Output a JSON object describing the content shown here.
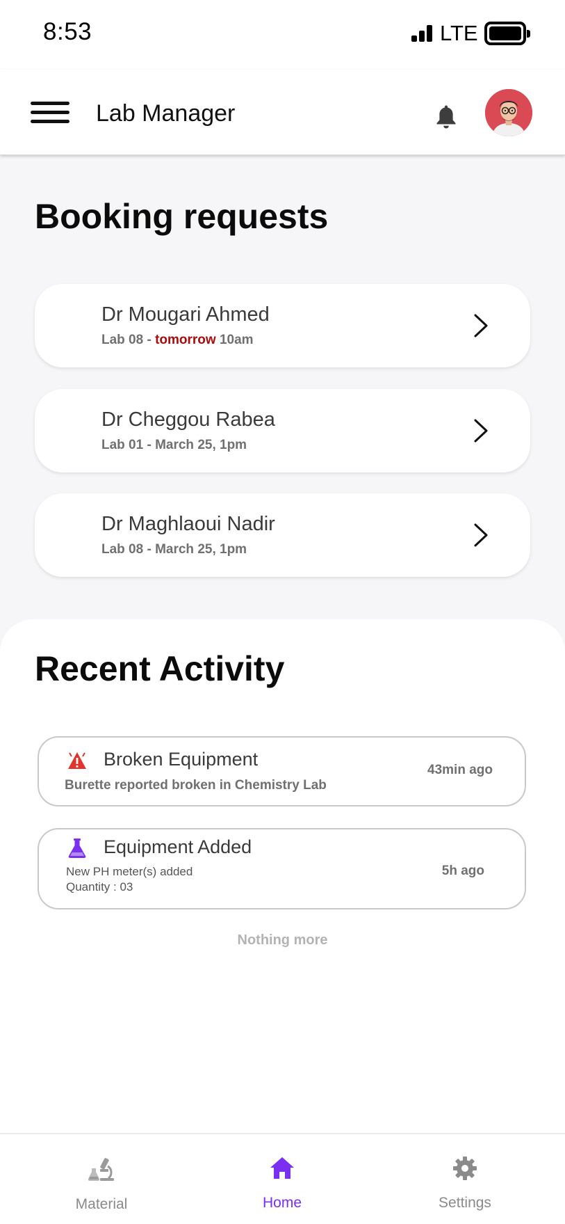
{
  "status_bar": {
    "time": "8:53",
    "network": "LTE"
  },
  "header": {
    "title": "Lab Manager"
  },
  "booking_section": {
    "title": "Booking requests",
    "items": [
      {
        "name": "Dr Mougari Ahmed",
        "lab": "Lab 08 - ",
        "highlight": "tomorrow",
        "time": " 10am"
      },
      {
        "name": "Dr Cheggou Rabea",
        "lab": "Lab 01 - March 25, 1pm",
        "highlight": "",
        "time": ""
      },
      {
        "name": "Dr Maghlaoui Nadir",
        "lab": "Lab 08 - March 25, 1pm",
        "highlight": "",
        "time": ""
      }
    ]
  },
  "activity_section": {
    "title": "Recent Activity",
    "items": [
      {
        "icon": "warning-icon",
        "title": "Broken Equipment",
        "description": "Burette reported broken in Chemistry Lab",
        "time": "43min ago"
      },
      {
        "icon": "flask-icon",
        "title": "Equipment Added",
        "line1": "New PH meter(s) added",
        "line2": "Quantity : 03",
        "time": "5h ago"
      }
    ],
    "footer": "Nothing more"
  },
  "bottom_nav": {
    "items": [
      {
        "label": "Material",
        "icon": "microscope-icon",
        "active": false
      },
      {
        "label": "Home",
        "icon": "home-icon",
        "active": true
      },
      {
        "label": "Settings",
        "icon": "gear-icon",
        "active": false
      }
    ]
  },
  "colors": {
    "accent": "#7b2ff0",
    "warning": "#e0342c",
    "highlight_text": "#a80d0d",
    "inactive_nav": "#8a8a8a"
  }
}
